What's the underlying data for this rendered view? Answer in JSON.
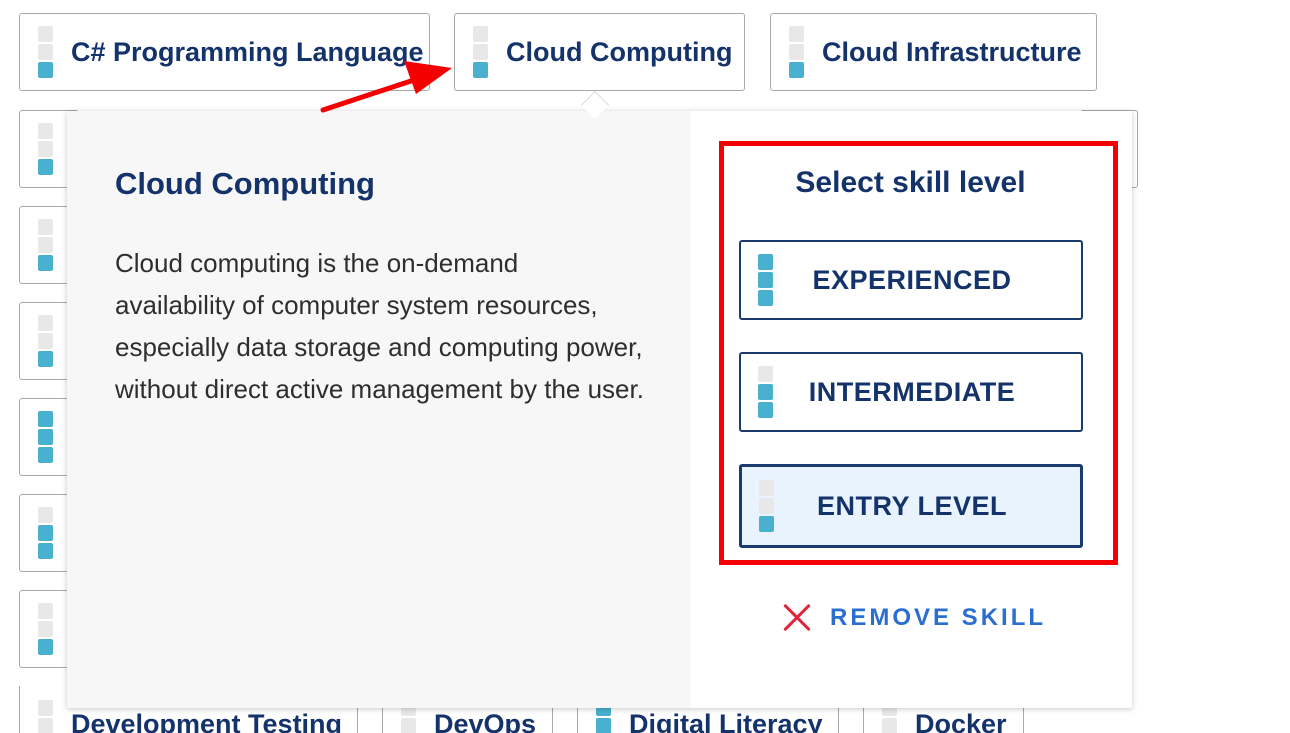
{
  "top_chips": [
    {
      "label": "C# Programming Language",
      "level": 1
    },
    {
      "label": "Cloud Computing",
      "level": 1
    },
    {
      "label": "Cloud Infrastructure",
      "level": 1
    }
  ],
  "bottom_chips": [
    {
      "label": "Development Testing"
    },
    {
      "label": "DevOps"
    },
    {
      "label": "Digital Literacy"
    },
    {
      "label": "Docker"
    }
  ],
  "popover": {
    "title": "Cloud Computing",
    "description": "Cloud computing is the on-demand availability of computer system resources, especially data storage and computing power, without direct active management by the user.",
    "select_title": "Select skill level",
    "levels": [
      {
        "label": "EXPERIENCED",
        "bars": 3,
        "selected": false
      },
      {
        "label": "INTERMEDIATE",
        "bars": 2,
        "selected": false
      },
      {
        "label": "ENTRY LEVEL",
        "bars": 1,
        "selected": true
      }
    ],
    "remove_label": "REMOVE SKILL"
  },
  "annotation_color": "#f50000"
}
